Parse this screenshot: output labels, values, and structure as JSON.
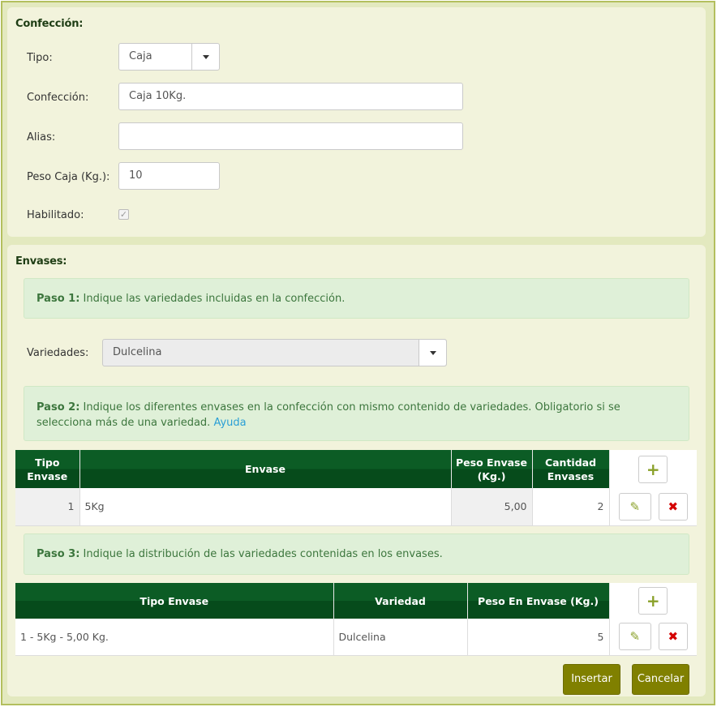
{
  "confeccion_section": {
    "title": "Confección:",
    "tipo": {
      "label": "Tipo:",
      "value": "Caja"
    },
    "confeccion": {
      "label": "Confección:",
      "value": "Caja 10Kg."
    },
    "alias": {
      "label": "Alias:",
      "value": ""
    },
    "peso_caja": {
      "label": "Peso Caja (Kg.):",
      "value": "10"
    },
    "habilitado": {
      "label": "Habilitado:",
      "checked": true,
      "check_glyph": "✓"
    }
  },
  "envases_section": {
    "title": "Envases:",
    "paso1": {
      "bold": "Paso 1:",
      "text": " Indique las variedades incluidas en la confección."
    },
    "variedades": {
      "label": "Variedades:",
      "value": "Dulcelina"
    },
    "paso2": {
      "bold": "Paso 2:",
      "text": " Indique los diferentes envases en la confección con mismo contenido de variedades. Obligatorio si se selecciona más de una variedad. ",
      "link": "Ayuda"
    },
    "envases_table": {
      "headers": [
        "Tipo Envase",
        "Envase",
        "Peso Envase (Kg.)",
        "Cantidad Envases"
      ],
      "rows": [
        {
          "tipo": "1",
          "envase": "5Kg",
          "peso": "5,00",
          "cantidad": "2"
        }
      ]
    },
    "paso3": {
      "bold": "Paso 3:",
      "text": " Indique la distribución de las variedades contenidas en los envases."
    },
    "distribucion_table": {
      "headers": [
        "Tipo Envase",
        "Variedad",
        "Peso En Envase (Kg.)"
      ],
      "rows": [
        {
          "tipo": "1 - 5Kg - 5,00 Kg.",
          "variedad": "Dulcelina",
          "peso": "5"
        }
      ]
    }
  },
  "actions": {
    "insertar": "Insertar",
    "cancelar": "Cancelar"
  },
  "icons": {
    "plus": "+",
    "edit": "✎",
    "delete": "✖"
  },
  "colors": {
    "accent_olive": "#808000",
    "table_header_green": "#0c5c25",
    "alert_green_bg": "#dff0d8",
    "delete_red": "#d40000"
  }
}
